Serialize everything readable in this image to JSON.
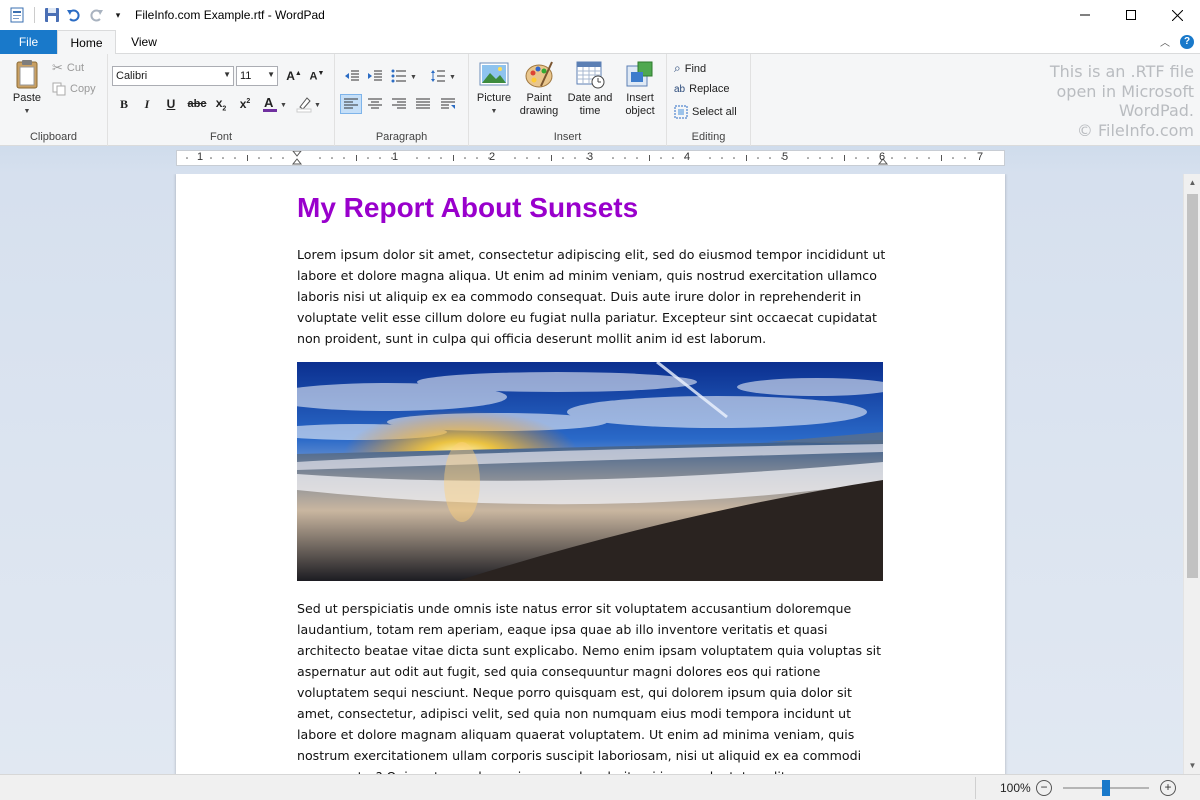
{
  "window": {
    "title": "FileInfo.com Example.rtf - WordPad",
    "controls": [
      "minimize-icon",
      "maximize-icon",
      "close-icon"
    ]
  },
  "tabs": {
    "file": "File",
    "home": "Home",
    "view": "View"
  },
  "ribbon": {
    "clipboard": {
      "label": "Clipboard",
      "paste": "Paste",
      "cut": "Cut",
      "copy": "Copy"
    },
    "font": {
      "label": "Font",
      "family": "Calibri",
      "size": "11"
    },
    "paragraph": {
      "label": "Paragraph"
    },
    "insert": {
      "label": "Insert",
      "picture": "Picture",
      "paint_drawing_1": "Paint",
      "paint_drawing_2": "drawing",
      "date_time_1": "Date and",
      "date_time_2": "time",
      "insert_object_1": "Insert",
      "insert_object_2": "object"
    },
    "editing": {
      "label": "Editing",
      "find": "Find",
      "replace": "Replace",
      "select_all": "Select all"
    },
    "watermark": {
      "line1": "This is an .RTF file",
      "line2": "open in Microsoft",
      "line3": "WordPad.",
      "line4": "© FileInfo.com"
    }
  },
  "ruler": {
    "numbers": [
      "1",
      "1",
      "2",
      "3",
      "4",
      "5",
      "6",
      "7"
    ]
  },
  "document": {
    "title": "My Report About Sunsets",
    "title_color": "#9900cc",
    "paragraph1": "Lorem ipsum dolor sit amet, consectetur adipiscing elit, sed do eiusmod tempor incididunt ut labore et dolore magna aliqua. Ut enim ad minim veniam, quis nostrud exercitation ullamco laboris nisi ut aliquip ex ea commodo consequat. Duis aute irure dolor in reprehenderit in voluptate velit esse cillum dolore eu fugiat nulla pariatur. Excepteur sint occaecat cupidatat non proident, sunt in culpa qui officia deserunt mollit anim id est laborum.",
    "paragraph2": "Sed ut perspiciatis unde omnis iste natus error sit voluptatem accusantium doloremque laudantium, totam rem aperiam, eaque ipsa quae ab illo inventore veritatis et quasi architecto beatae vitae dicta sunt explicabo. Nemo enim ipsam voluptatem quia voluptas sit aspernatur aut odit aut fugit, sed quia consequuntur magni dolores eos qui ratione voluptatem sequi nesciunt. Neque porro quisquam est, qui dolorem ipsum quia dolor sit amet, consectetur, adipisci velit, sed quia non numquam eius modi tempora incidunt ut labore et dolore magnam aliquam quaerat voluptatem. Ut enim ad minima veniam, quis nostrum exercitationem ullam corporis suscipit laboriosam, nisi ut aliquid ex ea commodi consequatur? Quis autem vel eum iure reprehenderit qui in ea voluptate velit esse quam"
  },
  "status": {
    "zoom": "100%",
    "zoom_minus": "−",
    "zoom_plus": "+"
  },
  "colors": {
    "accent": "#1979ca",
    "ribbon_bg": "#f5f6f7",
    "font_color": "#7030a0"
  }
}
